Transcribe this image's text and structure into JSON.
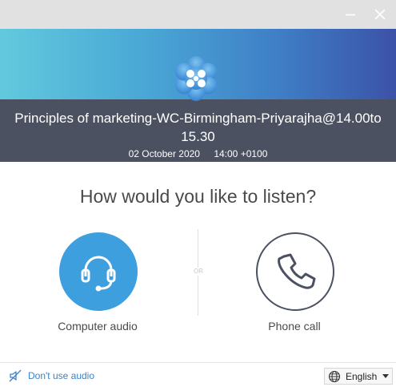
{
  "window": {
    "minimize_icon": "minimize-icon",
    "close_icon": "close-icon"
  },
  "meeting": {
    "title": "Principles of marketing-WC-Birmingham-Priyarajha@14.00to 15.30",
    "date": "02 October 2020",
    "time": "14:00 +0100"
  },
  "prompt": {
    "question": "How would you like to listen?",
    "or": "OR"
  },
  "options": {
    "computer": {
      "label": "Computer audio",
      "icon": "headset-icon"
    },
    "phone": {
      "label": "Phone call",
      "icon": "phone-icon"
    }
  },
  "footer": {
    "no_audio_label": "Don't use audio",
    "language": "English"
  },
  "colors": {
    "banner_start": "#62c9dd",
    "banner_end": "#3b52a8",
    "info_bg": "#4b5160",
    "accent": "#3e9fde",
    "link": "#3b83c9"
  }
}
